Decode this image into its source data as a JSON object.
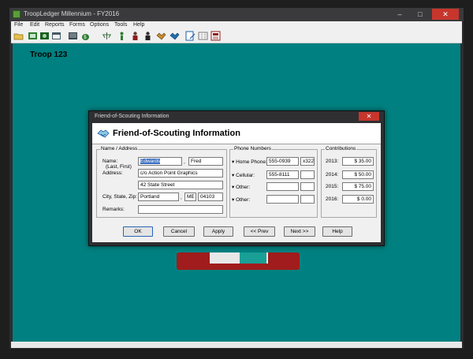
{
  "window": {
    "title": "TroopLedger Millennium - FY2016",
    "controls": {
      "minimize": "–",
      "maximize": "□",
      "close": "✕"
    }
  },
  "menu": [
    "File",
    "Edit",
    "Reports",
    "Forms",
    "Options",
    "Tools",
    "Help"
  ],
  "toolbar": {
    "icons": [
      "open-folder-icon",
      "record-icon",
      "account-icon",
      "calendar-icon",
      "money-bag-icon",
      "scales-icon",
      "scout-icon",
      "troop-icon",
      "leader-icon",
      "handshake-icon",
      "award-icon",
      "edit-form-icon",
      "grid-icon",
      "report-icon"
    ]
  },
  "client": {
    "troop_label": "Troop 123"
  },
  "dialog": {
    "title": "Friend-of-Scouting Information",
    "close": "✕",
    "heading": "Friend-of-Scouting Information",
    "name_address": {
      "group_title": "Name / Address",
      "name_label": "Name:",
      "name_hint": "(Last, First)",
      "last_name": "Edwards",
      "name_comma": ",",
      "first_name": "Fred",
      "address_label": "Address:",
      "address1": "c/o Action Point Graphics",
      "address2": "42 State Street",
      "csz_label": "City, State, Zip:",
      "city": "Portland",
      "city_comma": ",",
      "state": "ME",
      "zip": "04103",
      "remarks_label": "Remarks:",
      "remarks": ""
    },
    "phones": {
      "group_title": "Phone Numbers",
      "rows": [
        {
          "label": "Home Phone:",
          "number": "555-0939",
          "ext": "x322"
        },
        {
          "label": "Cellular:",
          "number": "555-8111",
          "ext": ""
        },
        {
          "label": "Other:",
          "number": "",
          "ext": ""
        },
        {
          "label": "Other:",
          "number": "",
          "ext": ""
        }
      ]
    },
    "contributions": {
      "group_title": "Contributions",
      "rows": [
        {
          "year": "2013:",
          "amount": "$ 35.00"
        },
        {
          "year": "2014:",
          "amount": "$ 50.00"
        },
        {
          "year": "2015:",
          "amount": "$ 75.00"
        },
        {
          "year": "2016:",
          "amount": "$ 0.00"
        }
      ]
    },
    "buttons": {
      "ok": "OK",
      "cancel": "Cancel",
      "apply": "Apply",
      "prev": "<< Prev",
      "next": "Next >>",
      "help": "Help"
    }
  },
  "colors": {
    "desktop": "#008080",
    "close_red": "#c7362c",
    "selection": "#3a6ec0"
  }
}
